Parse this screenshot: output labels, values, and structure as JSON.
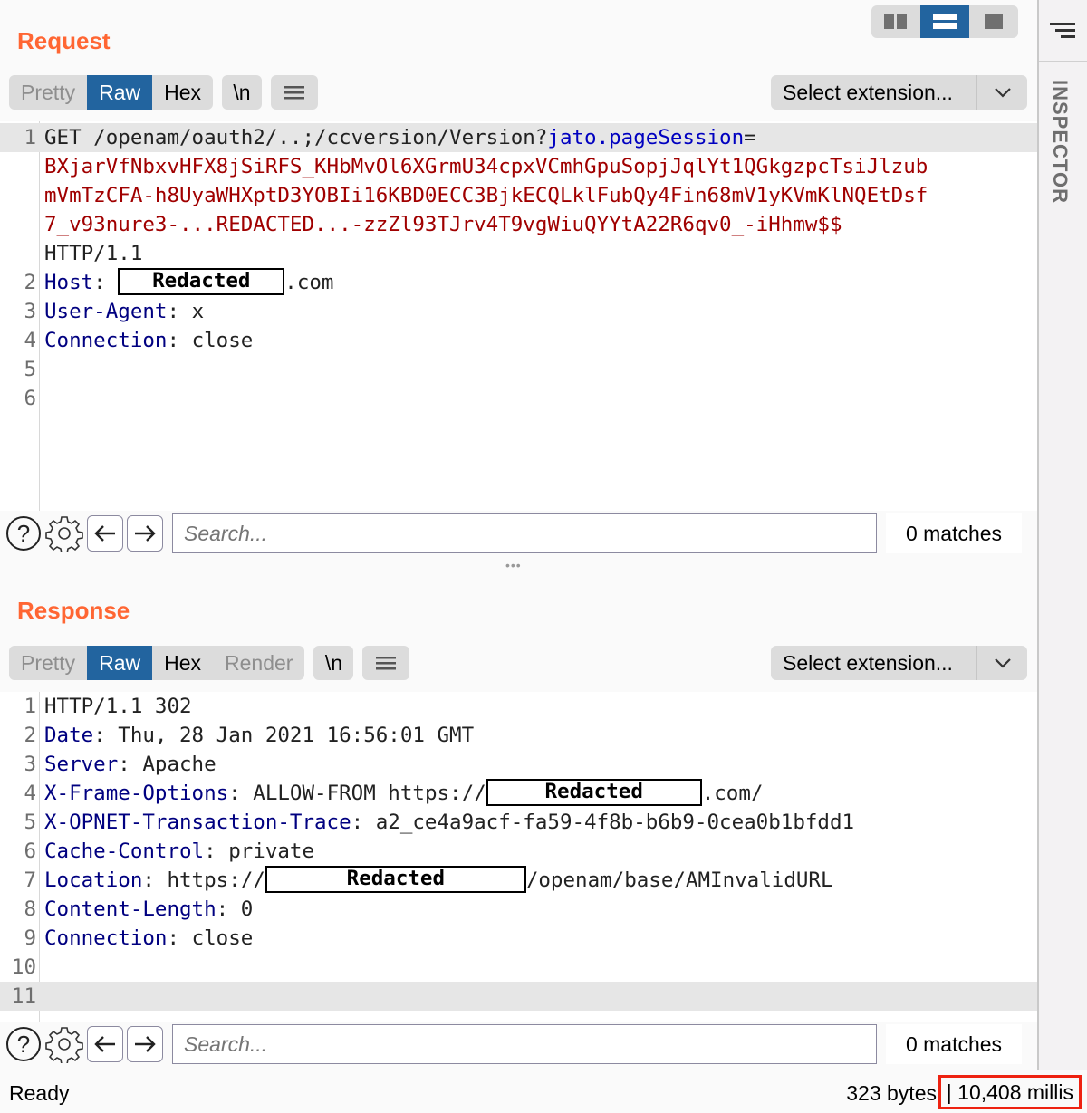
{
  "request": {
    "title": "Request",
    "tabs": [
      {
        "label": "Pretty",
        "state": "disabled"
      },
      {
        "label": "Raw",
        "state": "active"
      },
      {
        "label": "Hex",
        "state": "normal"
      }
    ],
    "newline_button": "\\n",
    "extension_select": "Select extension...",
    "lines": [
      {
        "num": "1",
        "method_path": "GET /openam/oauth2/..;/ccversion/Version?",
        "param_name": "jato.pageSession",
        "eq": "="
      },
      {
        "num": "",
        "text": "BXjarVfNbxvHFX8jSiRFS_KHbMvOl6XGrmU34cpxVCmhGpuSopjJqlYt1QGkgzpcTsiJlzub"
      },
      {
        "num": "",
        "text": "mVmTzCFA-h8UyaWHXptD3YOBIi16KBD0ECC3BjkECQLklFubQy4Fin68mV1yKVmKlNQEtDsf"
      },
      {
        "num": "",
        "text": "7_v93nure3-...REDACTED...-zzZl93TJrv4T9vgWiuQYYtA22R6qv0_-iHhmw$$"
      },
      {
        "num": "",
        "text": "HTTP/1.1"
      },
      {
        "num": "2",
        "name": "Host",
        "redacted": "Redacted",
        "suffix": ".com"
      },
      {
        "num": "3",
        "name": "User-Agent",
        "value": "x"
      },
      {
        "num": "4",
        "name": "Connection",
        "value": "close"
      },
      {
        "num": "5"
      },
      {
        "num": "6"
      }
    ],
    "search_placeholder": "Search...",
    "matches": "0 matches"
  },
  "response": {
    "title": "Response",
    "tabs": [
      {
        "label": "Pretty",
        "state": "disabled"
      },
      {
        "label": "Raw",
        "state": "active"
      },
      {
        "label": "Hex",
        "state": "normal"
      },
      {
        "label": "Render",
        "state": "disabled"
      }
    ],
    "newline_button": "\\n",
    "extension_select": "Select extension...",
    "lines": [
      {
        "num": "1",
        "text": "HTTP/1.1 302"
      },
      {
        "num": "2",
        "name": "Date",
        "value": "Thu, 28 Jan 2021 16:56:01 GMT"
      },
      {
        "num": "3",
        "name": "Server",
        "value": "Apache"
      },
      {
        "num": "4",
        "name": "X-Frame-Options",
        "value": "ALLOW-FROM https://",
        "redacted": "Redacted",
        "suffix": ".com/"
      },
      {
        "num": "5",
        "name": "X-OPNET-Transaction-Trace",
        "value": "a2_ce4a9acf-fa59-4f8b-b6b9-0cea0b1bfdd1"
      },
      {
        "num": "6",
        "name": "Cache-Control",
        "value": "private"
      },
      {
        "num": "7",
        "name": "Location",
        "value": "https://",
        "redacted": "Redacted",
        "suffix": "/openam/base/AMInvalidURL"
      },
      {
        "num": "8",
        "name": "Content-Length",
        "value": "0"
      },
      {
        "num": "9",
        "name": "Connection",
        "value": "close"
      },
      {
        "num": "10"
      },
      {
        "num": "11"
      }
    ],
    "search_placeholder": "Search...",
    "matches": "0 matches"
  },
  "inspector": {
    "label": "INSPECTOR"
  },
  "status": {
    "ready": "Ready",
    "bytes": "323 bytes",
    "millis": "| 10,408 millis"
  },
  "colors": {
    "accent_orange": "#ff6633",
    "active_tab": "#22649f",
    "header_name": "#000080",
    "param_value": "#a00000",
    "param_name": "#0000c0",
    "highlight_box": "#ee2211"
  }
}
